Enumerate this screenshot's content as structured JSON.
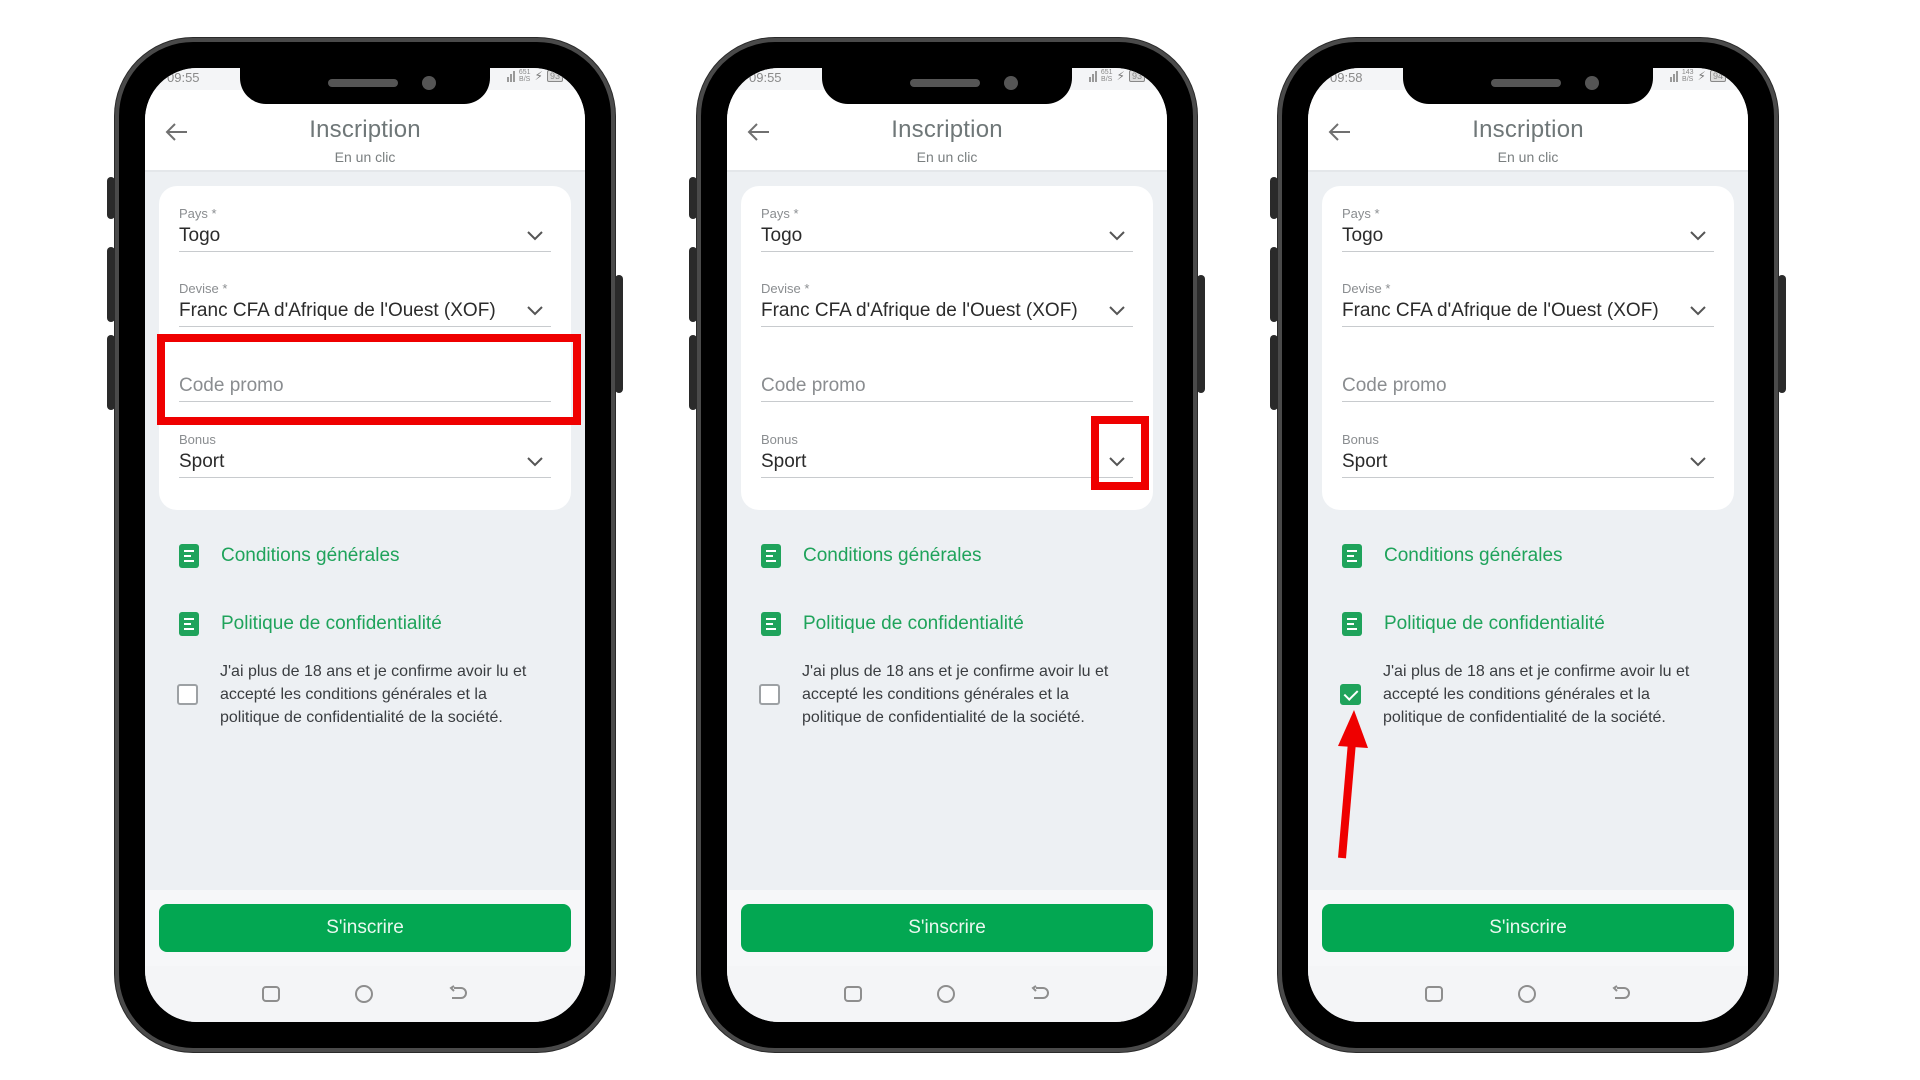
{
  "colors": {
    "accent_green": "#03a752",
    "link_green": "#1fa35b",
    "annotation_red": "#ef0000",
    "screen_background": "#edf0f3"
  },
  "phones": [
    {
      "status": {
        "time": "09:55",
        "net_speed_value": "651",
        "net_speed_unit": "B/S",
        "battery": "93"
      },
      "header": {
        "title": "Inscription",
        "subtitle": "En un clic"
      },
      "form": {
        "pays_label": "Pays *",
        "pays_value": "Togo",
        "devise_label": "Devise *",
        "devise_value": "Franc CFA d'Afrique de l'Ouest (XOF)",
        "promo_placeholder": "Code promo",
        "bonus_label": "Bonus",
        "bonus_value": "Sport"
      },
      "links": {
        "terms": "Conditions générales",
        "privacy": "Politique de confidentialité"
      },
      "consent": {
        "text": "J'ai plus de 18 ans et je confirme avoir lu et accepté les conditions générales et la politique de confidentialité de la société.",
        "checked": false
      },
      "submit_label": "S'inscrire",
      "annotation": "highlight-code-promo-field"
    },
    {
      "status": {
        "time": "09:55",
        "net_speed_value": "651",
        "net_speed_unit": "B/S",
        "battery": "93"
      },
      "header": {
        "title": "Inscription",
        "subtitle": "En un clic"
      },
      "form": {
        "pays_label": "Pays *",
        "pays_value": "Togo",
        "devise_label": "Devise *",
        "devise_value": "Franc CFA d'Afrique de l'Ouest (XOF)",
        "promo_placeholder": "Code promo",
        "bonus_label": "Bonus",
        "bonus_value": "Sport"
      },
      "links": {
        "terms": "Conditions générales",
        "privacy": "Politique de confidentialité"
      },
      "consent": {
        "text": "J'ai plus de 18 ans et je confirme avoir lu et accepté les conditions générales et la politique de confidentialité de la société.",
        "checked": false
      },
      "submit_label": "S'inscrire",
      "annotation": "highlight-bonus-dropdown-chevron"
    },
    {
      "status": {
        "time": "09:58",
        "net_speed_value": "143",
        "net_speed_unit": "B/S",
        "battery": "94"
      },
      "header": {
        "title": "Inscription",
        "subtitle": "En un clic"
      },
      "form": {
        "pays_label": "Pays *",
        "pays_value": "Togo",
        "devise_label": "Devise *",
        "devise_value": "Franc CFA d'Afrique de l'Ouest (XOF)",
        "promo_placeholder": "Code promo",
        "bonus_label": "Bonus",
        "bonus_value": "Sport"
      },
      "links": {
        "terms": "Conditions générales",
        "privacy": "Politique de confidentialité"
      },
      "consent": {
        "text": "J'ai plus de 18 ans et je confirme avoir lu et accepté les conditions générales et la politique de confidentialité de la société.",
        "checked": true
      },
      "submit_label": "S'inscrire",
      "annotation": "arrow-pointing-to-consent-checkbox"
    }
  ],
  "icons": {
    "back": "arrow-left-icon",
    "dropdown": "chevron-down-icon",
    "document": "document-icon",
    "checkbox": "checkbox-icon",
    "nav_recents": "square-icon",
    "nav_home": "circle-icon",
    "nav_back": "back-arrow-icon"
  }
}
